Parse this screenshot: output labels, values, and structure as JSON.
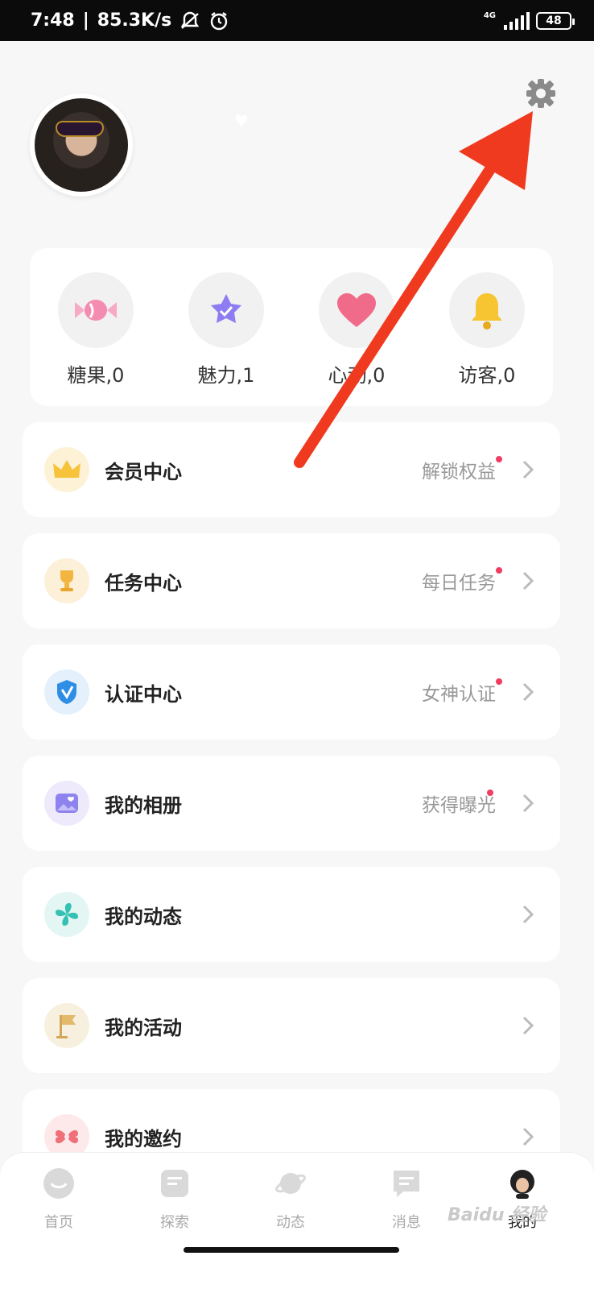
{
  "status_bar": {
    "time": "7:48",
    "speed": "85.3K/s",
    "network": "4G",
    "battery": "48"
  },
  "stats": [
    {
      "label": "糖果,0",
      "icon": "candy-icon"
    },
    {
      "label": "魅力,1",
      "icon": "star-icon"
    },
    {
      "label": "心动,0",
      "icon": "heart-icon"
    },
    {
      "label": "访客,0",
      "icon": "bell-icon"
    }
  ],
  "menu": [
    {
      "title": "会员中心",
      "hint": "解锁权益",
      "icon": "crown-icon",
      "color": "#fdf2d6"
    },
    {
      "title": "任务中心",
      "hint": "每日任务",
      "icon": "trophy-icon",
      "color": "#fdf0d9"
    },
    {
      "title": "认证中心",
      "hint": "女神认证",
      "icon": "shield-icon",
      "color": "#e4f0fb"
    },
    {
      "title": "我的相册",
      "hint": "获得曝光",
      "icon": "photo-icon",
      "color": "#eeeafb"
    },
    {
      "title": "我的动态",
      "hint": "",
      "icon": "pinwheel-icon",
      "color": "#e3f6f4"
    },
    {
      "title": "我的活动",
      "hint": "",
      "icon": "flag-icon",
      "color": "#f8f0de"
    },
    {
      "title": "我的邀约",
      "hint": "",
      "icon": "bow-icon",
      "color": "#fde9ea"
    }
  ],
  "tabs": [
    {
      "label": "首页",
      "icon": "smile-icon"
    },
    {
      "label": "探索",
      "icon": "explore-icon"
    },
    {
      "label": "动态",
      "icon": "planet-icon"
    },
    {
      "label": "消息",
      "icon": "message-icon"
    },
    {
      "label": "我的",
      "icon": "profile-icon"
    }
  ],
  "watermark": "Baidu 经验",
  "colors": {
    "accent_dot": "#f23d62",
    "arrow": "#f03a1f"
  }
}
